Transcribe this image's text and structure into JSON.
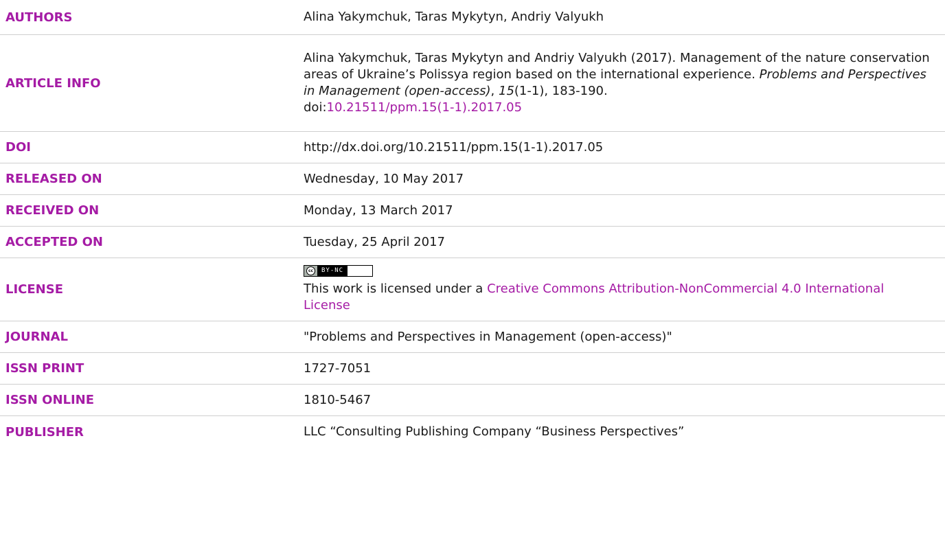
{
  "rows": {
    "authors": {
      "label": "AUTHORS",
      "value": "Alina Yakymchuk, Taras Mykytyn, Andriy Valyukh"
    },
    "article_info": {
      "label": "ARTICLE INFO",
      "citation_pre": "Alina Yakymchuk, Taras Mykytyn and Andriy Valyukh (2017). Management of the nature conservation areas of Ukraine’s Polissya region based on the international experience. ",
      "journal_italic": "Problems and Perspectives in Management (open-access)",
      "sep1": ", ",
      "volume_italic": "15",
      "issue_pages": "(1-1), 183-190.",
      "doi_prefix": "doi:",
      "doi_link": "10.21511/ppm.15(1-1).2017.05"
    },
    "doi": {
      "label": "DOI",
      "value": "http://dx.doi.org/10.21511/ppm.15(1-1).2017.05"
    },
    "released": {
      "label": "RELEASED ON",
      "value": "Wednesday, 10 May 2017"
    },
    "received": {
      "label": "RECEIVED ON",
      "value": "Monday, 13 March 2017"
    },
    "accepted": {
      "label": "ACCEPTED ON",
      "value": "Tuesday, 25 April 2017"
    },
    "license": {
      "label": "LICENSE",
      "badge_cc": "cc",
      "badge_text": "BY-NC",
      "text_pre": "This work is licensed under a ",
      "link": "Creative Commons Attribution-NonCommercial 4.0 International License"
    },
    "journal": {
      "label": "JOURNAL",
      "value": "\"Problems and Perspectives in Management (open-access)\""
    },
    "issn_print": {
      "label": "ISSN PRINT",
      "value": "1727-7051"
    },
    "issn_online": {
      "label": "ISSN ONLINE",
      "value": "1810-5467"
    },
    "publisher": {
      "label": "PUBLISHER",
      "value": "LLC “Consulting Publishing Company “Business Perspectives”"
    }
  },
  "colors": {
    "label_accent": "#a51ba5",
    "link": "#a51ba5",
    "divider": "#cfcfcf"
  }
}
